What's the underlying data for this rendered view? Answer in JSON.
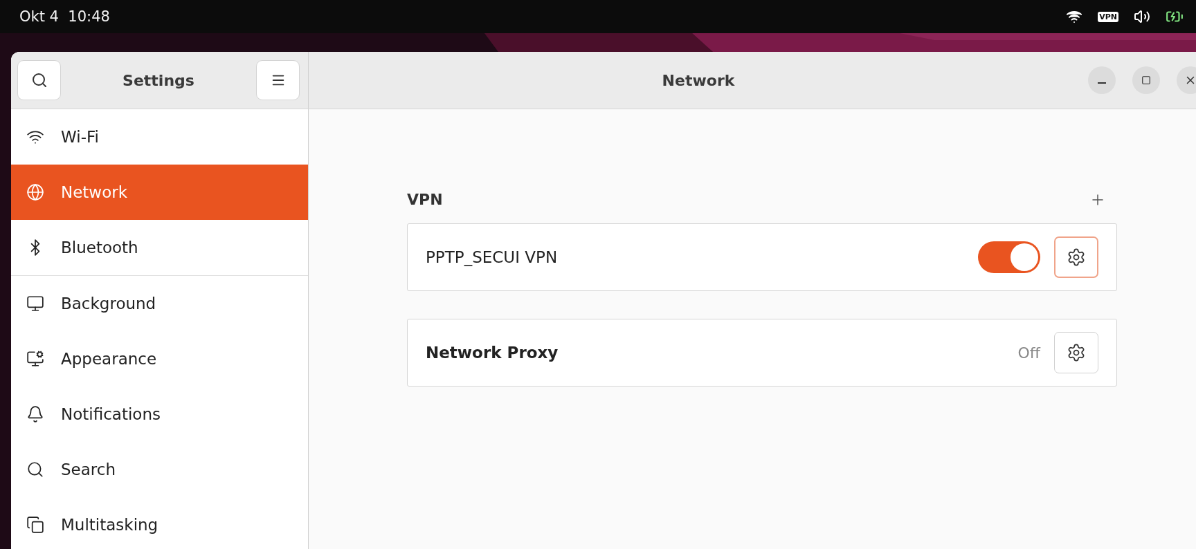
{
  "top_bar": {
    "date": "Okt 4",
    "time": "10:48",
    "vpn_indicator": "VPN"
  },
  "window": {
    "sidebar_title": "Settings",
    "title": "Network"
  },
  "sidebar": {
    "items": [
      {
        "label": "Wi-Fi",
        "selected": false,
        "divider_after": false
      },
      {
        "label": "Network",
        "selected": true,
        "divider_after": false
      },
      {
        "label": "Bluetooth",
        "selected": false,
        "divider_after": true
      },
      {
        "label": "Background",
        "selected": false,
        "divider_after": false
      },
      {
        "label": "Appearance",
        "selected": false,
        "divider_after": false
      },
      {
        "label": "Notifications",
        "selected": false,
        "divider_after": false
      },
      {
        "label": "Search",
        "selected": false,
        "divider_after": false
      },
      {
        "label": "Multitasking",
        "selected": false,
        "divider_after": false
      }
    ]
  },
  "vpn": {
    "heading": "VPN",
    "connections": [
      {
        "name": "PPTP_SECUI VPN",
        "on": true
      }
    ]
  },
  "proxy": {
    "label": "Network Proxy",
    "status": "Off"
  }
}
